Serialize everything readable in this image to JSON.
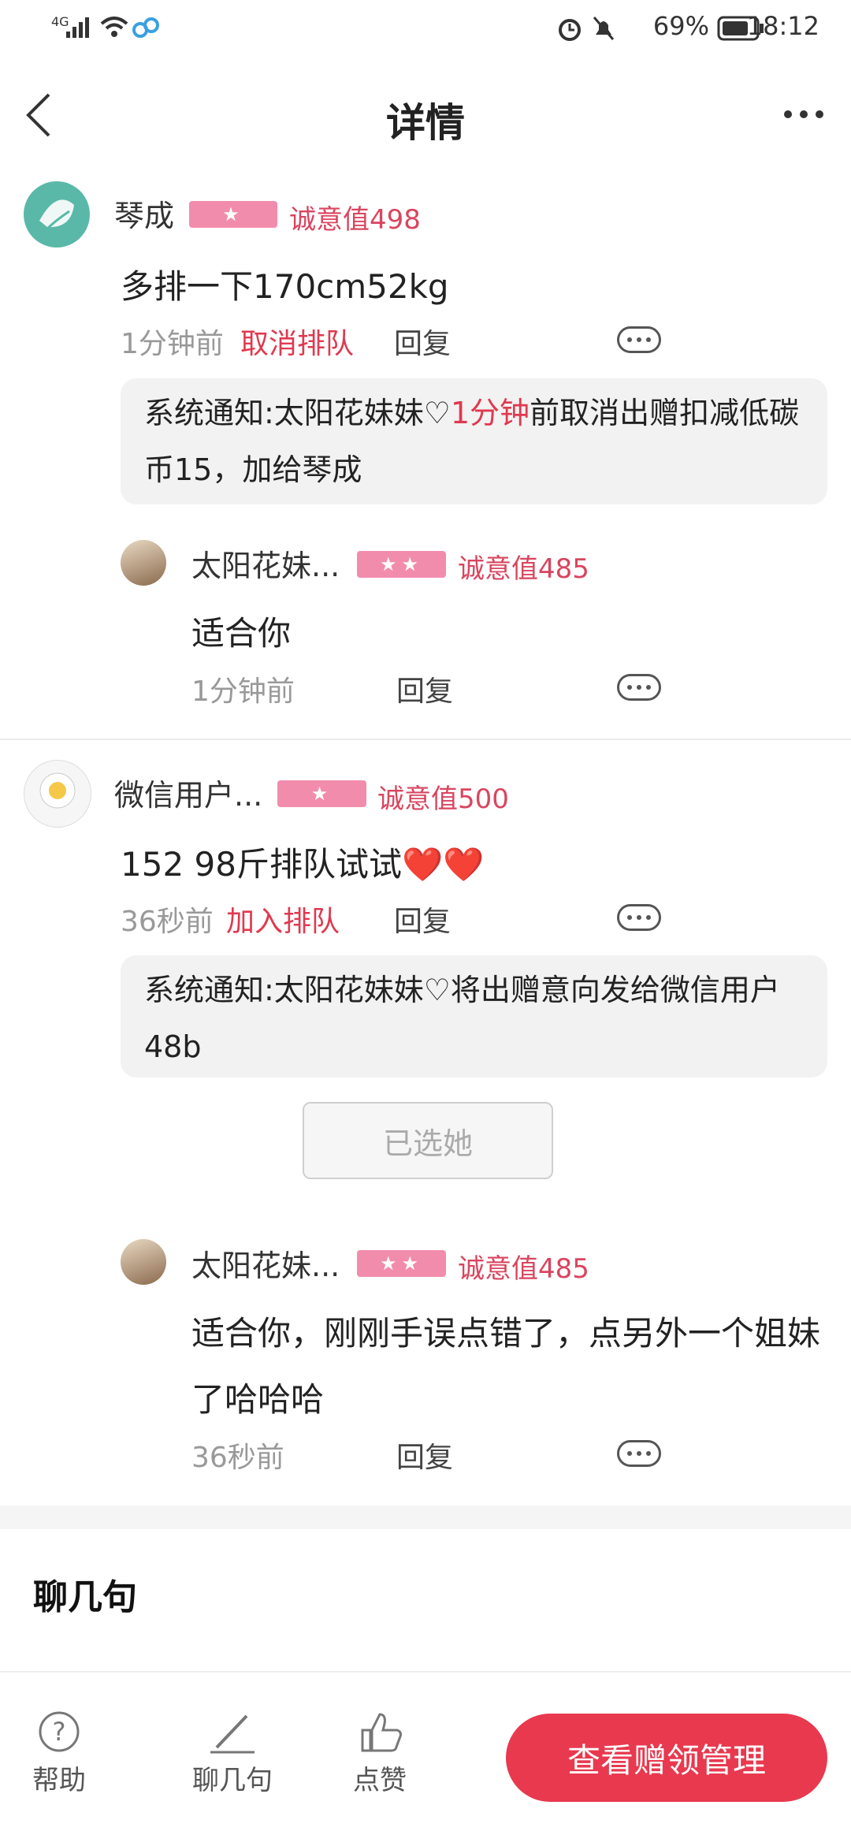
{
  "status_bar": {
    "network": "4G",
    "battery": "69%",
    "time": "18:12"
  },
  "header": {
    "title": "详情"
  },
  "comments": [
    {
      "name": "琴成",
      "sincerity": "诚意值498",
      "content": "多排一下170cm52kg",
      "time": "1分钟前",
      "action": "取消排队",
      "reply": "回复",
      "notice_prefix": "系统通知:太阳花妹妹♡",
      "notice_highlight": "1分钟",
      "notice_suffix": "前取消出赠扣减低碳币15，加给琴成",
      "sub": {
        "name": "太阳花妹...",
        "sincerity": "诚意值485",
        "content": "适合你",
        "time": "1分钟前",
        "reply": "回复"
      }
    },
    {
      "name": "微信用户...",
      "sincerity": "诚意值500",
      "content": "152 98斤排队试试❤️❤️",
      "time": "36秒前",
      "action": "加入排队",
      "reply": "回复",
      "notice_text": "系统通知:太阳花妹妹♡将出赠意向发给微信用户48b",
      "chosen": "已选她",
      "sub": {
        "name": "太阳花妹...",
        "sincerity": "诚意值485",
        "content": "适合你，刚刚手误点错了，点另外一个姐妹了哈哈哈",
        "time": "36秒前",
        "reply": "回复"
      }
    }
  ],
  "chat_section": {
    "title": "聊几句"
  },
  "bottom_bar": {
    "help": "帮助",
    "chat": "聊几句",
    "like": "点赞",
    "cta": "查看赠领管理"
  },
  "colors": {
    "accent": "#e8394f",
    "badge": "#f28cad",
    "sincerity": "#d9455f"
  }
}
